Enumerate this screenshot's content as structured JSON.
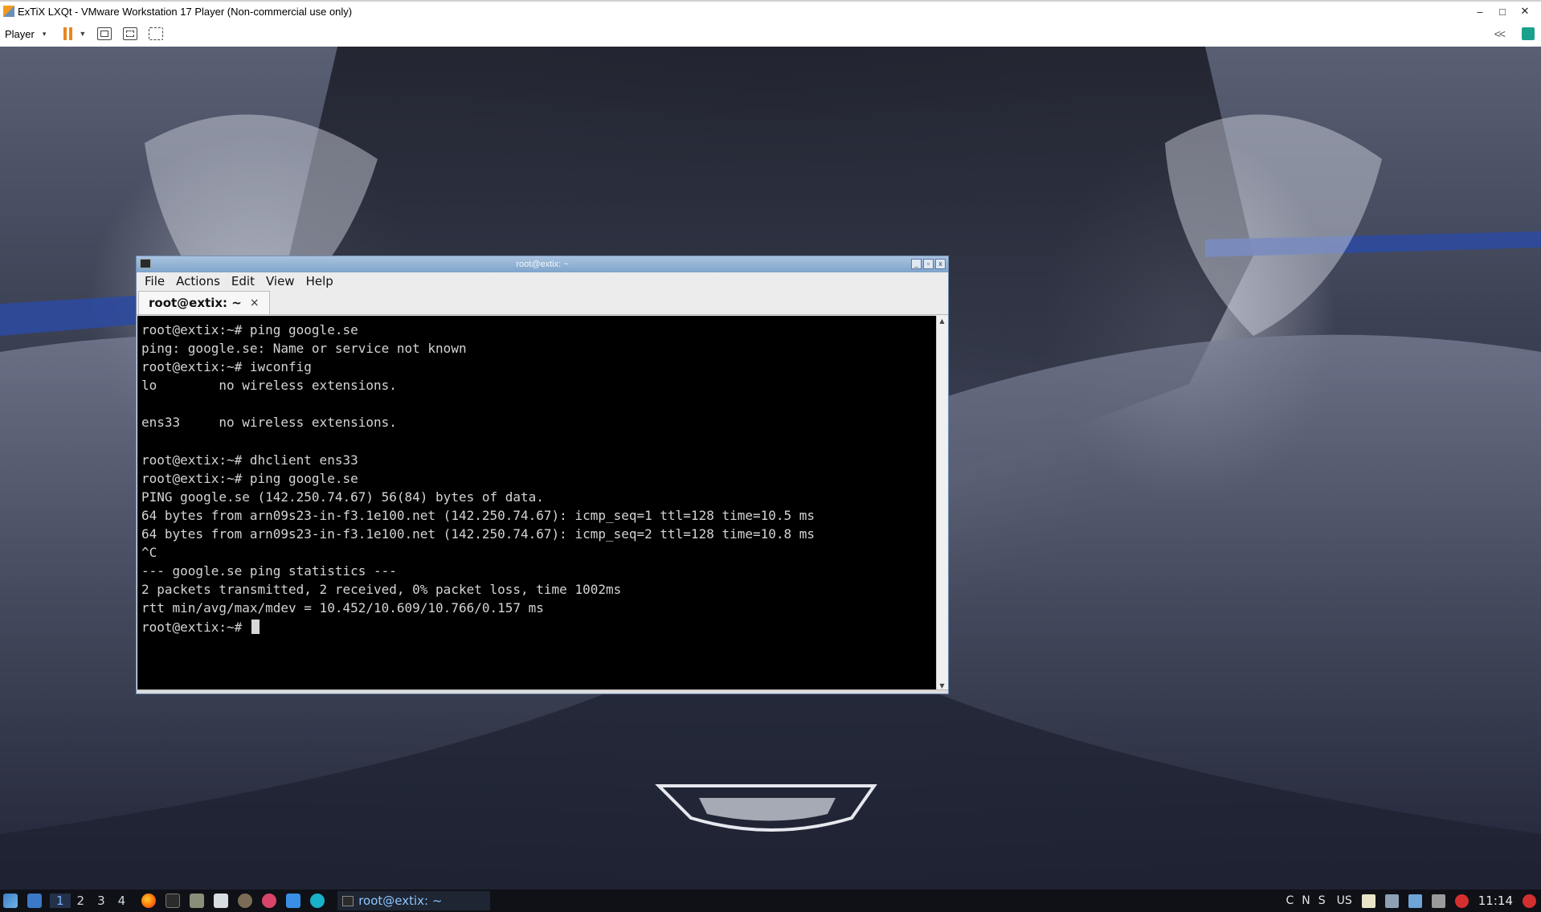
{
  "host": {
    "title": "ExTiX LXQt - VMware Workstation 17 Player (Non-commercial use only)",
    "player_menu": "Player",
    "window_buttons": [
      "–",
      "□",
      "✕"
    ],
    "collapse_label": "<<"
  },
  "terminal": {
    "window_title": "root@extix: ~",
    "menu": [
      "File",
      "Actions",
      "Edit",
      "View",
      "Help"
    ],
    "tab_label": "root@extix: ~",
    "tab_close": "×",
    "lines": [
      "root@extix:~# ping google.se",
      "ping: google.se: Name or service not known",
      "root@extix:~# iwconfig",
      "lo        no wireless extensions.",
      "",
      "ens33     no wireless extensions.",
      "",
      "root@extix:~# dhclient ens33",
      "root@extix:~# ping google.se",
      "PING google.se (142.250.74.67) 56(84) bytes of data.",
      "64 bytes from arn09s23-in-f3.1e100.net (142.250.74.67): icmp_seq=1 ttl=128 time=10.5 ms",
      "64 bytes from arn09s23-in-f3.1e100.net (142.250.74.67): icmp_seq=2 ttl=128 time=10.8 ms",
      "^C",
      "--- google.se ping statistics ---",
      "2 packets transmitted, 2 received, 0% packet loss, time 1002ms",
      "rtt min/avg/max/mdev = 10.452/10.609/10.766/0.157 ms"
    ],
    "prompt": "root@extix:~# "
  },
  "panel": {
    "workspaces": [
      "1",
      "2",
      "3",
      "4"
    ],
    "active_workspace": "1",
    "task_label": "root@extix: ~",
    "keyboard_indicators": [
      "C",
      "N",
      "S"
    ],
    "layout": "US",
    "clock": "11:14"
  },
  "colors": {
    "terminal_bg": "#000000",
    "terminal_fg": "#d4d4d4",
    "titlebar_blue": "#7fa4cc",
    "panel_bg": "#0f1117",
    "vmware_orange": "#e8871e"
  }
}
